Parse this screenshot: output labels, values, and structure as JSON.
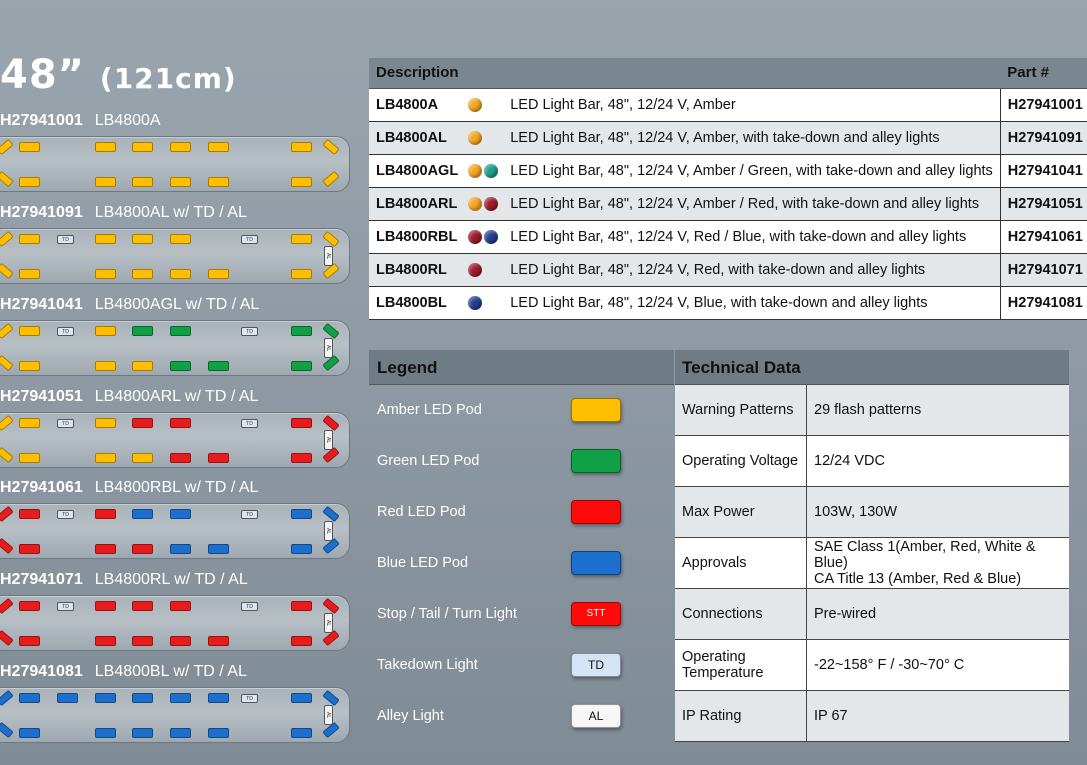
{
  "header": {
    "size": "48”",
    "metric": "(121cm)"
  },
  "lightbars": [
    {
      "part": "H27941001",
      "model": "LB4800A"
    },
    {
      "part": "H27941091",
      "model": "LB4800AL w/ TD / AL"
    },
    {
      "part": "H27941041",
      "model": "LB4800AGL w/ TD / AL"
    },
    {
      "part": "H27941051",
      "model": "LB4800ARL w/ TD / AL"
    },
    {
      "part": "H27941061",
      "model": "LB4800RBL w/ TD / AL"
    },
    {
      "part": "H27941071",
      "model": "LB4800RL w/ TD / AL"
    },
    {
      "part": "H27941081",
      "model": "LB4800BL w/ TD / AL"
    }
  ],
  "pod_labels": {
    "td": "TD",
    "al": "AL"
  },
  "description_table": {
    "headers": {
      "description": "Description",
      "part": "Part #"
    },
    "rows": [
      {
        "model": "LB4800A",
        "colors": [
          "#f5a623"
        ],
        "description": "LED Light Bar, 48\", 12/24 V, Amber",
        "part": "H27941001"
      },
      {
        "model": "LB4800AL",
        "colors": [
          "#f5a623"
        ],
        "description": "LED Light Bar, 48\", 12/24 V, Amber, with take-down and alley lights",
        "part": "H27941091"
      },
      {
        "model": "LB4800AGL",
        "colors": [
          "#f5a623",
          "#1a9e8c"
        ],
        "description": "LED Light Bar, 48\",  12/24  V, Amber / Green, with take-down and alley lights",
        "part": "H27941041"
      },
      {
        "model": "LB4800ARL",
        "colors": [
          "#f5a623",
          "#a01c2c"
        ],
        "description": "LED Light Bar, 48\",  12/24  V, Amber / Red, with take-down and alley lights",
        "part": "H27941051"
      },
      {
        "model": "LB4800RBL",
        "colors": [
          "#a01c2c",
          "#23408f"
        ],
        "description": "LED Light Bar, 48\",  12/24  V, Red / Blue, with take-down and alley lights",
        "part": "H27941061"
      },
      {
        "model": "LB4800RL",
        "colors": [
          "#a01c2c"
        ],
        "description": "LED Light Bar, 48\",  12/24  V, Red, with take-down and alley lights",
        "part": "H27941071"
      },
      {
        "model": "LB4800BL",
        "colors": [
          "#23408f"
        ],
        "description": "LED Light Bar, 48\",  12/24  V, Blue, with take-down and alley lights",
        "part": "H27941081"
      }
    ]
  },
  "legend": {
    "title": "Legend",
    "items": [
      {
        "label": "Amber LED Pod",
        "color": "#ffbf00",
        "text": ""
      },
      {
        "label": "Green LED Pod",
        "color": "#12a046",
        "text": ""
      },
      {
        "label": "Red LED Pod",
        "color": "#ff0a0a",
        "text": ""
      },
      {
        "label": "Blue LED Pod",
        "color": "#1c6fcc",
        "text": ""
      },
      {
        "label": "Stop / Tail / Turn Light",
        "color": "#ff0a0a",
        "text": "STT"
      },
      {
        "label": "Takedown Light",
        "color": "#d5e4f5",
        "text": "TD"
      },
      {
        "label": "Alley Light",
        "color": "#f6f6f6",
        "text": "AL"
      }
    ]
  },
  "technical": {
    "title": "Technical Data",
    "rows": [
      {
        "key": "Warning Patterns",
        "value": "29 flash patterns"
      },
      {
        "key": "Operating Voltage",
        "value": "12/24 VDC"
      },
      {
        "key": "Max Power",
        "value": "103W, 130W"
      },
      {
        "key": "Approvals",
        "value": "SAE Class 1(Amber, Red, White & Blue)\nCA Title 13 (Amber, Red & Blue)"
      },
      {
        "key": "Connections",
        "value": "Pre-wired"
      },
      {
        "key": "Operating\nTemperature",
        "value": "-22~158° F  / -30~70° C"
      },
      {
        "key": "IP Rating",
        "value": "IP 67"
      }
    ]
  }
}
